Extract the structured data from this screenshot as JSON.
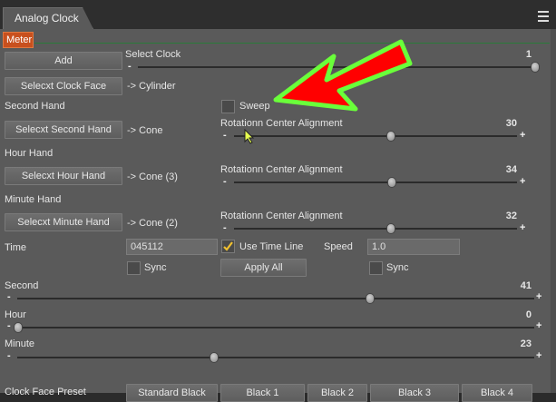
{
  "window": {
    "tab_label": "Analog Clock",
    "sub_tab_label": "Meter"
  },
  "colors": {
    "accent": "#c8501e",
    "panel": "#5a5a5a",
    "background": "#2b2b2b",
    "annotation_arrow": "#ff0000",
    "annotation_outline": "#6aff3a"
  },
  "buttons": {
    "add": "Add",
    "clock_face": "Selecxt Clock Face",
    "second_hand": "Selecxt Second Hand",
    "hour_hand": "Selecxt Hour Hand",
    "minute_hand": "Selecxt Minute Hand",
    "apply_all": "Apply All"
  },
  "select_clock": {
    "label": "Select Clock",
    "value": "1",
    "fraction": 1.0
  },
  "clock_face": {
    "selection": "-> Cylinder"
  },
  "second_hand": {
    "section": "Second Hand",
    "selection": "-> Cone",
    "sweep_label": "Sweep",
    "rotation_label": "Rotationn Center Alignment",
    "rotation_value": "30",
    "fraction": 0.5
  },
  "hour_hand": {
    "section": "Hour Hand",
    "selection": "-> Cone (3)",
    "rotation_label": "Rotationn Center Alignment",
    "rotation_value": "34",
    "fraction": 0.5
  },
  "minute_hand": {
    "section": "Minute Hand",
    "selection": "-> Cone (2)",
    "rotation_label": "Rotationn Center Alignment",
    "rotation_value": "32",
    "fraction": 0.5
  },
  "time_row": {
    "time_label": "Time",
    "time_value": "045112",
    "use_time_line_label": "Use Time Line",
    "use_time_line_checked": true,
    "speed_label": "Speed",
    "speed_value": "1.0",
    "sync_label_1": "Sync",
    "sync_label_2": "Sync"
  },
  "second_slider": {
    "label": "Second",
    "value": "41",
    "fraction": 0.68
  },
  "hour_slider": {
    "label": "Hour",
    "value": "0",
    "fraction": 0.0
  },
  "minute_slider": {
    "label": "Minute",
    "value": "23",
    "fraction": 0.38
  },
  "presets": {
    "label": "Clock Face Preset",
    "items": [
      "Standard Black",
      "Black 1",
      "Black 2",
      "Black 3",
      "Black 4"
    ]
  },
  "slider_signs": {
    "minus": "-",
    "plus": "+"
  },
  "icons": {
    "panel_menu": "hamburger-menu-icon",
    "cursor": "mouse-cursor-icon",
    "annotation": "arrow-icon"
  }
}
